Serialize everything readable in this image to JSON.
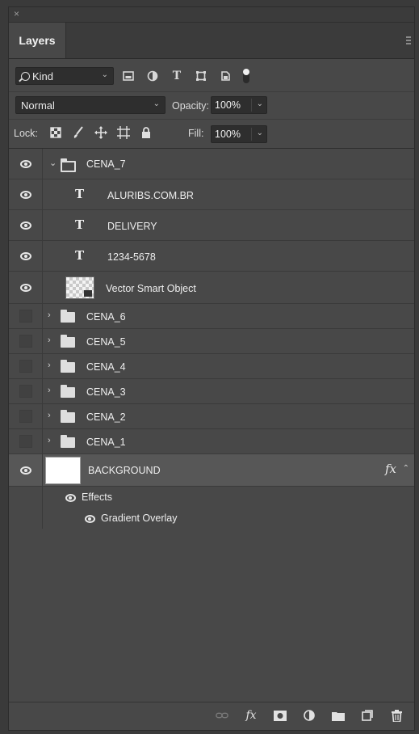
{
  "window": {
    "close_glyph": "×"
  },
  "panel": {
    "tab_label": "Layers"
  },
  "filter": {
    "kind_label": "Kind",
    "icons": [
      "image-filter-icon",
      "adjustment-filter-icon",
      "type-filter-icon",
      "shape-filter-icon",
      "smart-object-filter-icon",
      "filter-toggle-icon"
    ]
  },
  "blend": {
    "mode": "Normal",
    "opacity_label": "Opacity:",
    "opacity_value": "100%"
  },
  "lock": {
    "label": "Lock:",
    "icons": [
      "lock-transparent-pixels-icon",
      "lock-image-pixels-icon",
      "lock-position-icon",
      "lock-artboard-icon",
      "lock-all-icon"
    ],
    "fill_label": "Fill:",
    "fill_value": "100%"
  },
  "layers": {
    "cena7": {
      "name": "CENA_7",
      "visible": true,
      "expanded": true
    },
    "text1": {
      "name": "ALURIBS.COM.BR",
      "visible": true
    },
    "text2": {
      "name": "DELIVERY",
      "visible": true
    },
    "text3": {
      "name": "1234-5678",
      "visible": true
    },
    "smart": {
      "name": "Vector Smart Object",
      "visible": true
    },
    "cena6": {
      "name": "CENA_6",
      "visible": false
    },
    "cena5": {
      "name": "CENA_5",
      "visible": false
    },
    "cena4": {
      "name": "CENA_4",
      "visible": false
    },
    "cena3": {
      "name": "CENA_3",
      "visible": false
    },
    "cena2": {
      "name": "CENA_2",
      "visible": false
    },
    "cena1": {
      "name": "CENA_1",
      "visible": false
    },
    "background": {
      "name": "BACKGROUND",
      "visible": true,
      "fx_label": "fx"
    },
    "effects_label": "Effects",
    "gradient_overlay_label": "Gradient Overlay",
    "type_glyph": "T"
  },
  "bottom_icons": [
    "link-layers-icon",
    "layer-style-icon",
    "layer-mask-icon",
    "adjustment-layer-icon",
    "new-group-icon",
    "new-layer-icon",
    "delete-icon"
  ],
  "bottom": {
    "fx_label": "fx"
  },
  "colors": {
    "panel_bg": "#484848",
    "selected_row": "#575757",
    "field_bg": "#2e2e2e"
  }
}
